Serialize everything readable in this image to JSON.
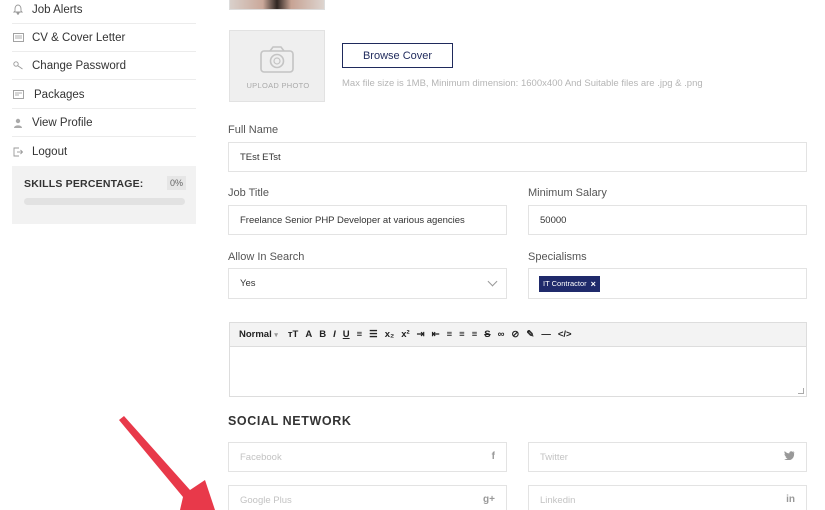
{
  "sidebar": {
    "items": [
      {
        "label": "Job Alerts",
        "icon": "bell-icon"
      },
      {
        "label": "CV & Cover Letter",
        "icon": "document-icon"
      },
      {
        "label": "Change Password",
        "icon": "key-icon"
      },
      {
        "label": "Packages",
        "icon": "package-icon"
      },
      {
        "label": "View Profile",
        "icon": "user-icon"
      },
      {
        "label": "Logout",
        "icon": "logout-icon"
      }
    ],
    "skills": {
      "title": "SKILLS PERCENTAGE:",
      "value": "0%",
      "progress": 0
    }
  },
  "upload": {
    "label": "UPLOAD PHOTO",
    "browse_label": "Browse Cover",
    "hint": "Max file size is 1MB, Minimum dimension: 1600x400 And Suitable files are .jpg & .png"
  },
  "form": {
    "full_name_label": "Full Name",
    "full_name_value": "TEst ETst",
    "job_title_label": "Job Title",
    "job_title_value": "Freelance Senior PHP Developer at various agencies",
    "min_salary_label": "Minimum Salary",
    "min_salary_value": "50000",
    "allow_search_label": "Allow In Search",
    "allow_search_value": "Yes",
    "specialisms_label": "Specialisms",
    "specialisms_tag": "IT Contractor"
  },
  "editor": {
    "format_label": "Normal"
  },
  "social": {
    "title": "SOCIAL NETWORK",
    "facebook_placeholder": "Facebook",
    "twitter_placeholder": "Twitter",
    "google_placeholder": "Google Plus",
    "linkedin_placeholder": "Linkedin"
  },
  "colors": {
    "accent": "#1f2a6b",
    "arrow": "#e8394a"
  }
}
